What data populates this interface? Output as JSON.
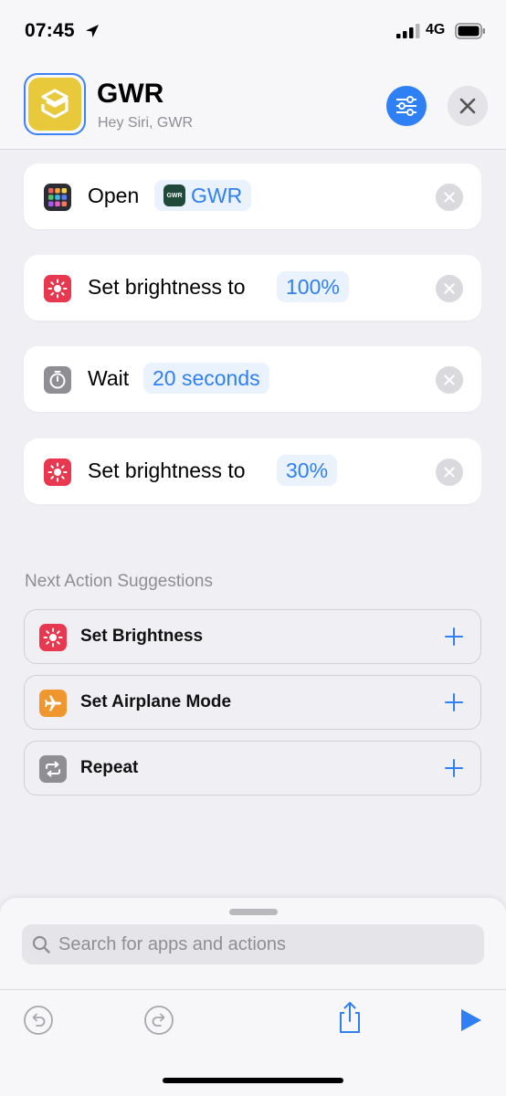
{
  "status_bar": {
    "time": "07:45",
    "network": "4G",
    "icons": [
      "location-arrow-icon",
      "signal-bars-icon",
      "battery-icon"
    ]
  },
  "header": {
    "title": "GWR",
    "subtitle": "Hey Siri, GWR",
    "app_icon": "shortcuts-icon",
    "accent_color": "#e8c93c"
  },
  "actions": [
    {
      "label": "Open",
      "param": "GWR",
      "param_app_icon": "GWR",
      "icon": "app-grid-icon",
      "icon_color": "#2c2c34"
    },
    {
      "label": "Set brightness to",
      "param": "100%",
      "icon": "brightness-icon",
      "icon_color": "#e8384f"
    },
    {
      "label": "Wait",
      "param": "20 seconds",
      "icon": "timer-icon",
      "icon_color": "#8e8e93"
    },
    {
      "label": "Set brightness to",
      "param": "30%",
      "icon": "brightness-icon",
      "icon_color": "#e8384f"
    }
  ],
  "suggestions": {
    "heading": "Next Action Suggestions",
    "items": [
      {
        "label": "Set Brightness",
        "icon": "brightness-icon",
        "icon_color": "#e8384f"
      },
      {
        "label": "Set Airplane Mode",
        "icon": "airplane-icon",
        "icon_color": "#f0962e"
      },
      {
        "label": "Repeat",
        "icon": "repeat-icon",
        "icon_color": "#8e8e93"
      }
    ]
  },
  "search": {
    "placeholder": "Search for apps and actions",
    "value": ""
  },
  "toolbar": {
    "items": [
      "undo-icon",
      "redo-icon",
      "share-icon",
      "play-icon"
    ]
  },
  "colors": {
    "accent_blue": "#2f7ff5",
    "background": "#efeff4"
  }
}
